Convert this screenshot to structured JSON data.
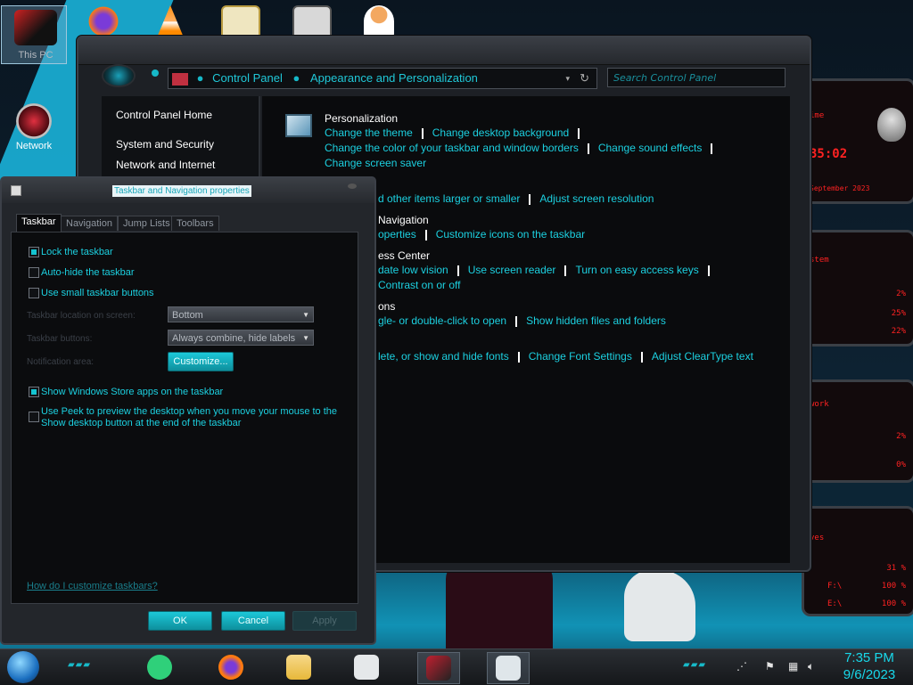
{
  "desktop": {
    "icons": [
      {
        "label": "This PC"
      },
      {
        "label": "Network"
      }
    ]
  },
  "control_panel": {
    "breadcrumb": [
      "Control Panel",
      "Appearance and Personalization"
    ],
    "search_placeholder": "Search Control Panel",
    "sidebar": [
      "Control Panel Home",
      "System and Security",
      "Network and Internet"
    ],
    "personalization": {
      "title": "Personalization",
      "links_row1": [
        "Change the theme",
        "Change desktop background"
      ],
      "links_row2": [
        "Change the color of your taskbar and window borders",
        "Change sound effects"
      ],
      "links_row3": [
        "Change screen saver"
      ]
    },
    "display_links": [
      "d other items larger or smaller",
      "Adjust screen resolution"
    ],
    "taskbar_nav_title": "Navigation",
    "taskbar_nav_links": [
      "operties",
      "Customize icons on the taskbar"
    ],
    "ease_title": "ess Center",
    "ease_links": [
      "date low vision",
      "Use screen reader",
      "Turn on easy access keys"
    ],
    "ease_links2": [
      "Contrast on or off"
    ],
    "folder_title": "ons",
    "folder_links": [
      "gle- or double-click to open",
      "Show hidden files and folders"
    ],
    "fonts_links": [
      "lete, or show and hide fonts",
      "Change Font Settings",
      "Adjust ClearType text"
    ]
  },
  "dialog": {
    "title": "Taskbar and Navigation properties",
    "tabs": [
      "Taskbar",
      "Navigation",
      "Jump Lists",
      "Toolbars"
    ],
    "checkboxes": [
      {
        "label": "Lock the taskbar",
        "checked": true
      },
      {
        "label": "Auto-hide the taskbar",
        "checked": false
      },
      {
        "label": "Use small taskbar buttons",
        "checked": false
      },
      {
        "label": "Show Windows Store apps on the taskbar",
        "checked": true
      },
      {
        "label": "Use Peek to preview the desktop when you move your mouse to the",
        "label2": "Show desktop button at the end of the taskbar",
        "checked": false
      }
    ],
    "location_label": "Taskbar location on screen:",
    "location_value": "Bottom",
    "buttons_label": "Taskbar buttons:",
    "buttons_value": "Always combine, hide labels",
    "notification_label": "Notification area:",
    "customize": "Customize...",
    "help_link": "How do I customize taskbars?",
    "ok": "OK",
    "cancel": "Cancel",
    "apply": "Apply"
  },
  "gadgets": {
    "clock_label": "ime",
    "clock_time": "35:02",
    "date": "September 2023",
    "system_title": "stem",
    "cpu1": "2%",
    "cpu2": "25%",
    "cpu3": "22%",
    "network_title": "work",
    "net1": "2%",
    "net2": "0%",
    "drives_title": "ves",
    "drv1": "31 %",
    "drv2": "100 %",
    "drv3": "100 %",
    "drv_f": "F:\\",
    "drv_e": "E:\\"
  },
  "taskbar": {
    "time": "7:35 PM",
    "date": "9/6/2023"
  },
  "colors": {
    "accent": "#1cd0e0",
    "background": "#0a0b0d",
    "gadget_red": "#ff2222"
  }
}
